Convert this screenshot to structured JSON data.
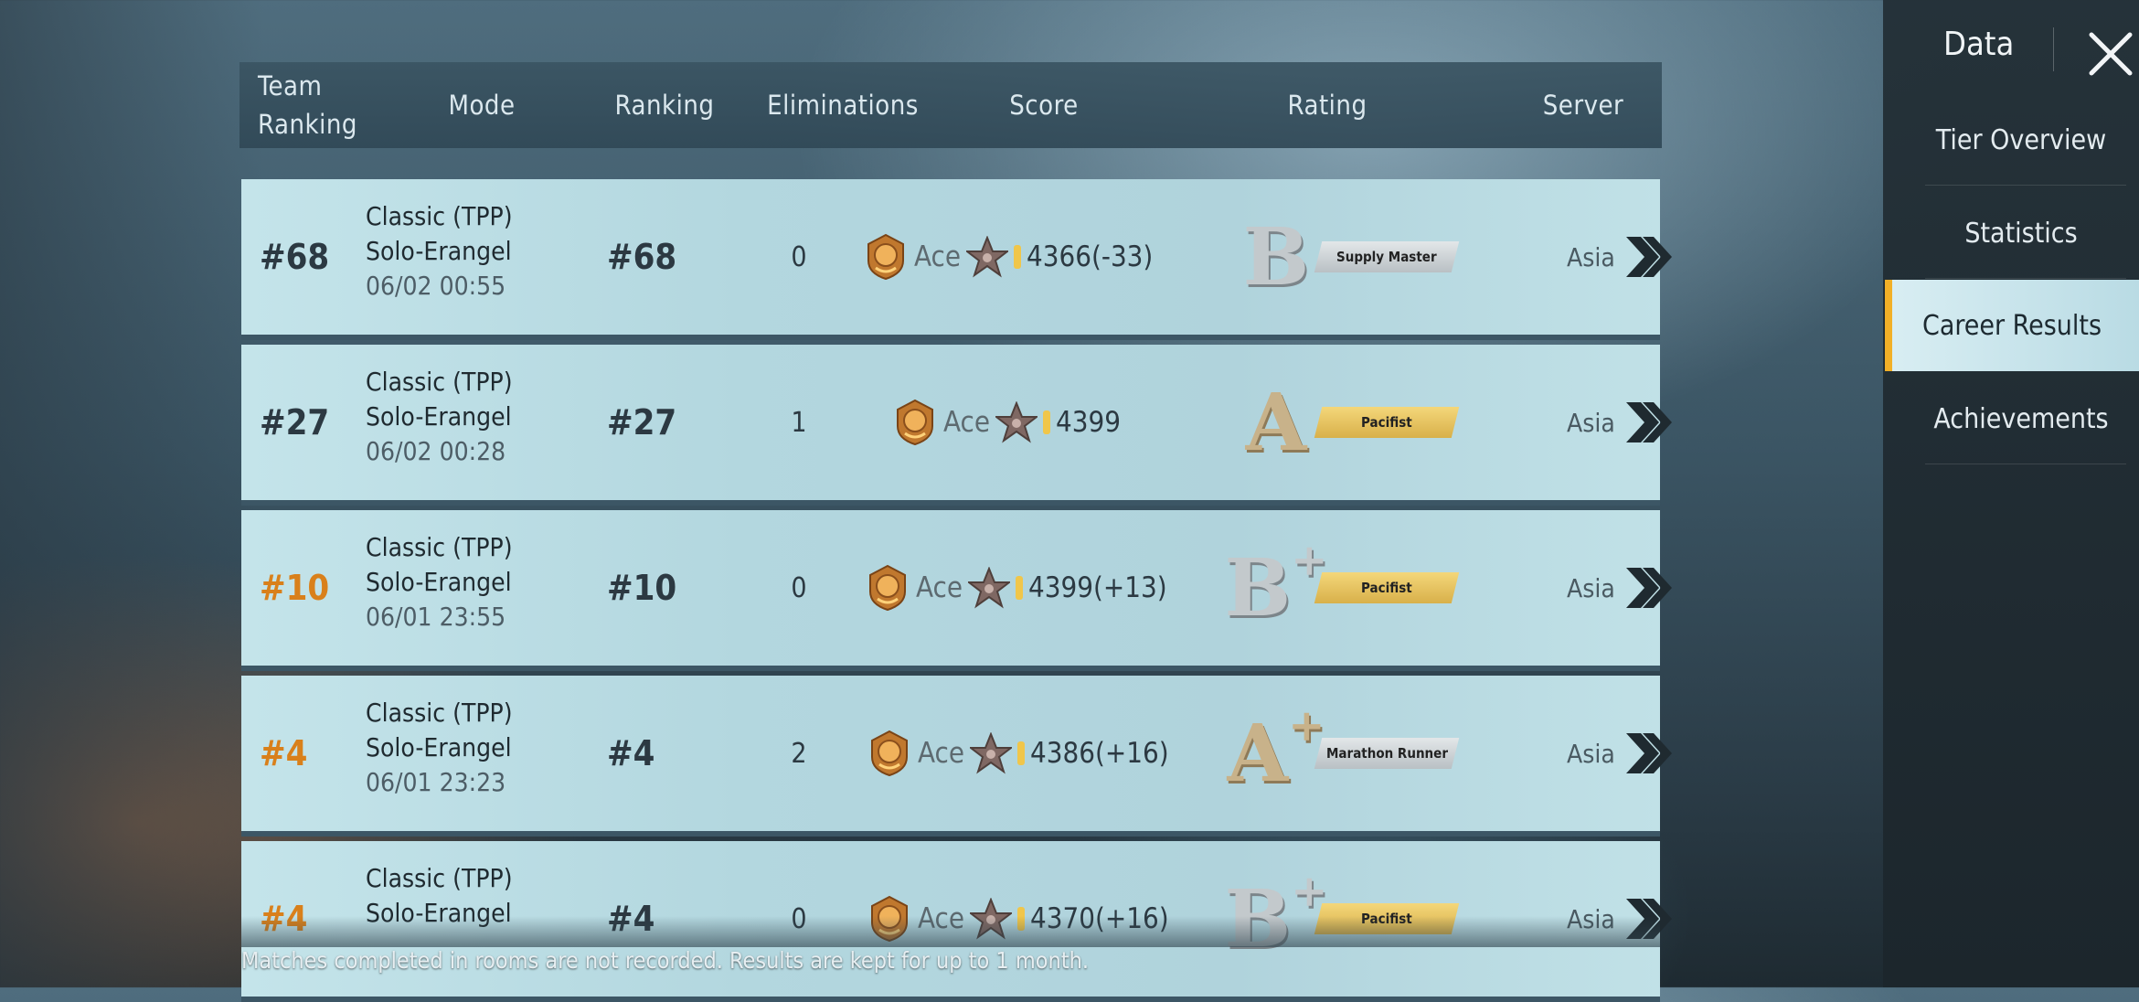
{
  "header": {
    "team_ranking_line1": "Team",
    "team_ranking_line2": "Ranking",
    "mode": "Mode",
    "ranking": "Ranking",
    "eliminations": "Eliminations",
    "score": "Score",
    "rating": "Rating",
    "server": "Server"
  },
  "rows": [
    {
      "team_rank": "#68",
      "mode": "Classic (TPP)",
      "map": "Solo-Erangel",
      "date": "06/02 00:55",
      "ranking": "#68",
      "eliminations": "0",
      "tier": "Ace",
      "score": "4366(-33)",
      "grade": "B",
      "grade_plus": "",
      "badge": "Supply Master",
      "server": "Asia"
    },
    {
      "team_rank": "#27",
      "mode": "Classic (TPP)",
      "map": "Solo-Erangel",
      "date": "06/02 00:28",
      "ranking": "#27",
      "eliminations": "1",
      "tier": "Ace",
      "score": "4399",
      "grade": "A",
      "grade_plus": "",
      "badge": "Pacifist",
      "server": "Asia"
    },
    {
      "team_rank": "#10",
      "mode": "Classic (TPP)",
      "map": "Solo-Erangel",
      "date": "06/01 23:55",
      "ranking": "#10",
      "eliminations": "0",
      "tier": "Ace",
      "score": "4399(+13)",
      "grade": "B",
      "grade_plus": "+",
      "badge": "Pacifist",
      "server": "Asia"
    },
    {
      "team_rank": "#4",
      "mode": "Classic (TPP)",
      "map": "Solo-Erangel",
      "date": "06/01 23:23",
      "ranking": "#4",
      "eliminations": "2",
      "tier": "Ace",
      "score": "4386(+16)",
      "grade": "A",
      "grade_plus": "+",
      "badge": "Marathon Runner",
      "server": "Asia"
    },
    {
      "team_rank": "#4",
      "mode": "Classic (TPP)",
      "map": "Solo-Erangel",
      "date": "",
      "ranking": "#4",
      "eliminations": "0",
      "tier": "Ace",
      "score": "4370(+16)",
      "grade": "B",
      "grade_plus": "+",
      "badge": "Pacifist",
      "server": "Asia"
    }
  ],
  "footer_note": "Matches completed in rooms are not recorded. Results are kept for up to 1 month.",
  "panel": {
    "title": "Data",
    "nav": [
      "Tier Overview",
      "Statistics",
      "Career Results",
      "Achievements"
    ],
    "active_index": 2
  },
  "colors": {
    "row_bg": "#b3d7df",
    "accent": "#f2b027",
    "top_rank": "#d9801b"
  },
  "icons": [
    "ace-crest-icon",
    "ace-star-icon",
    "chevron-right-icon",
    "close-icon"
  ]
}
